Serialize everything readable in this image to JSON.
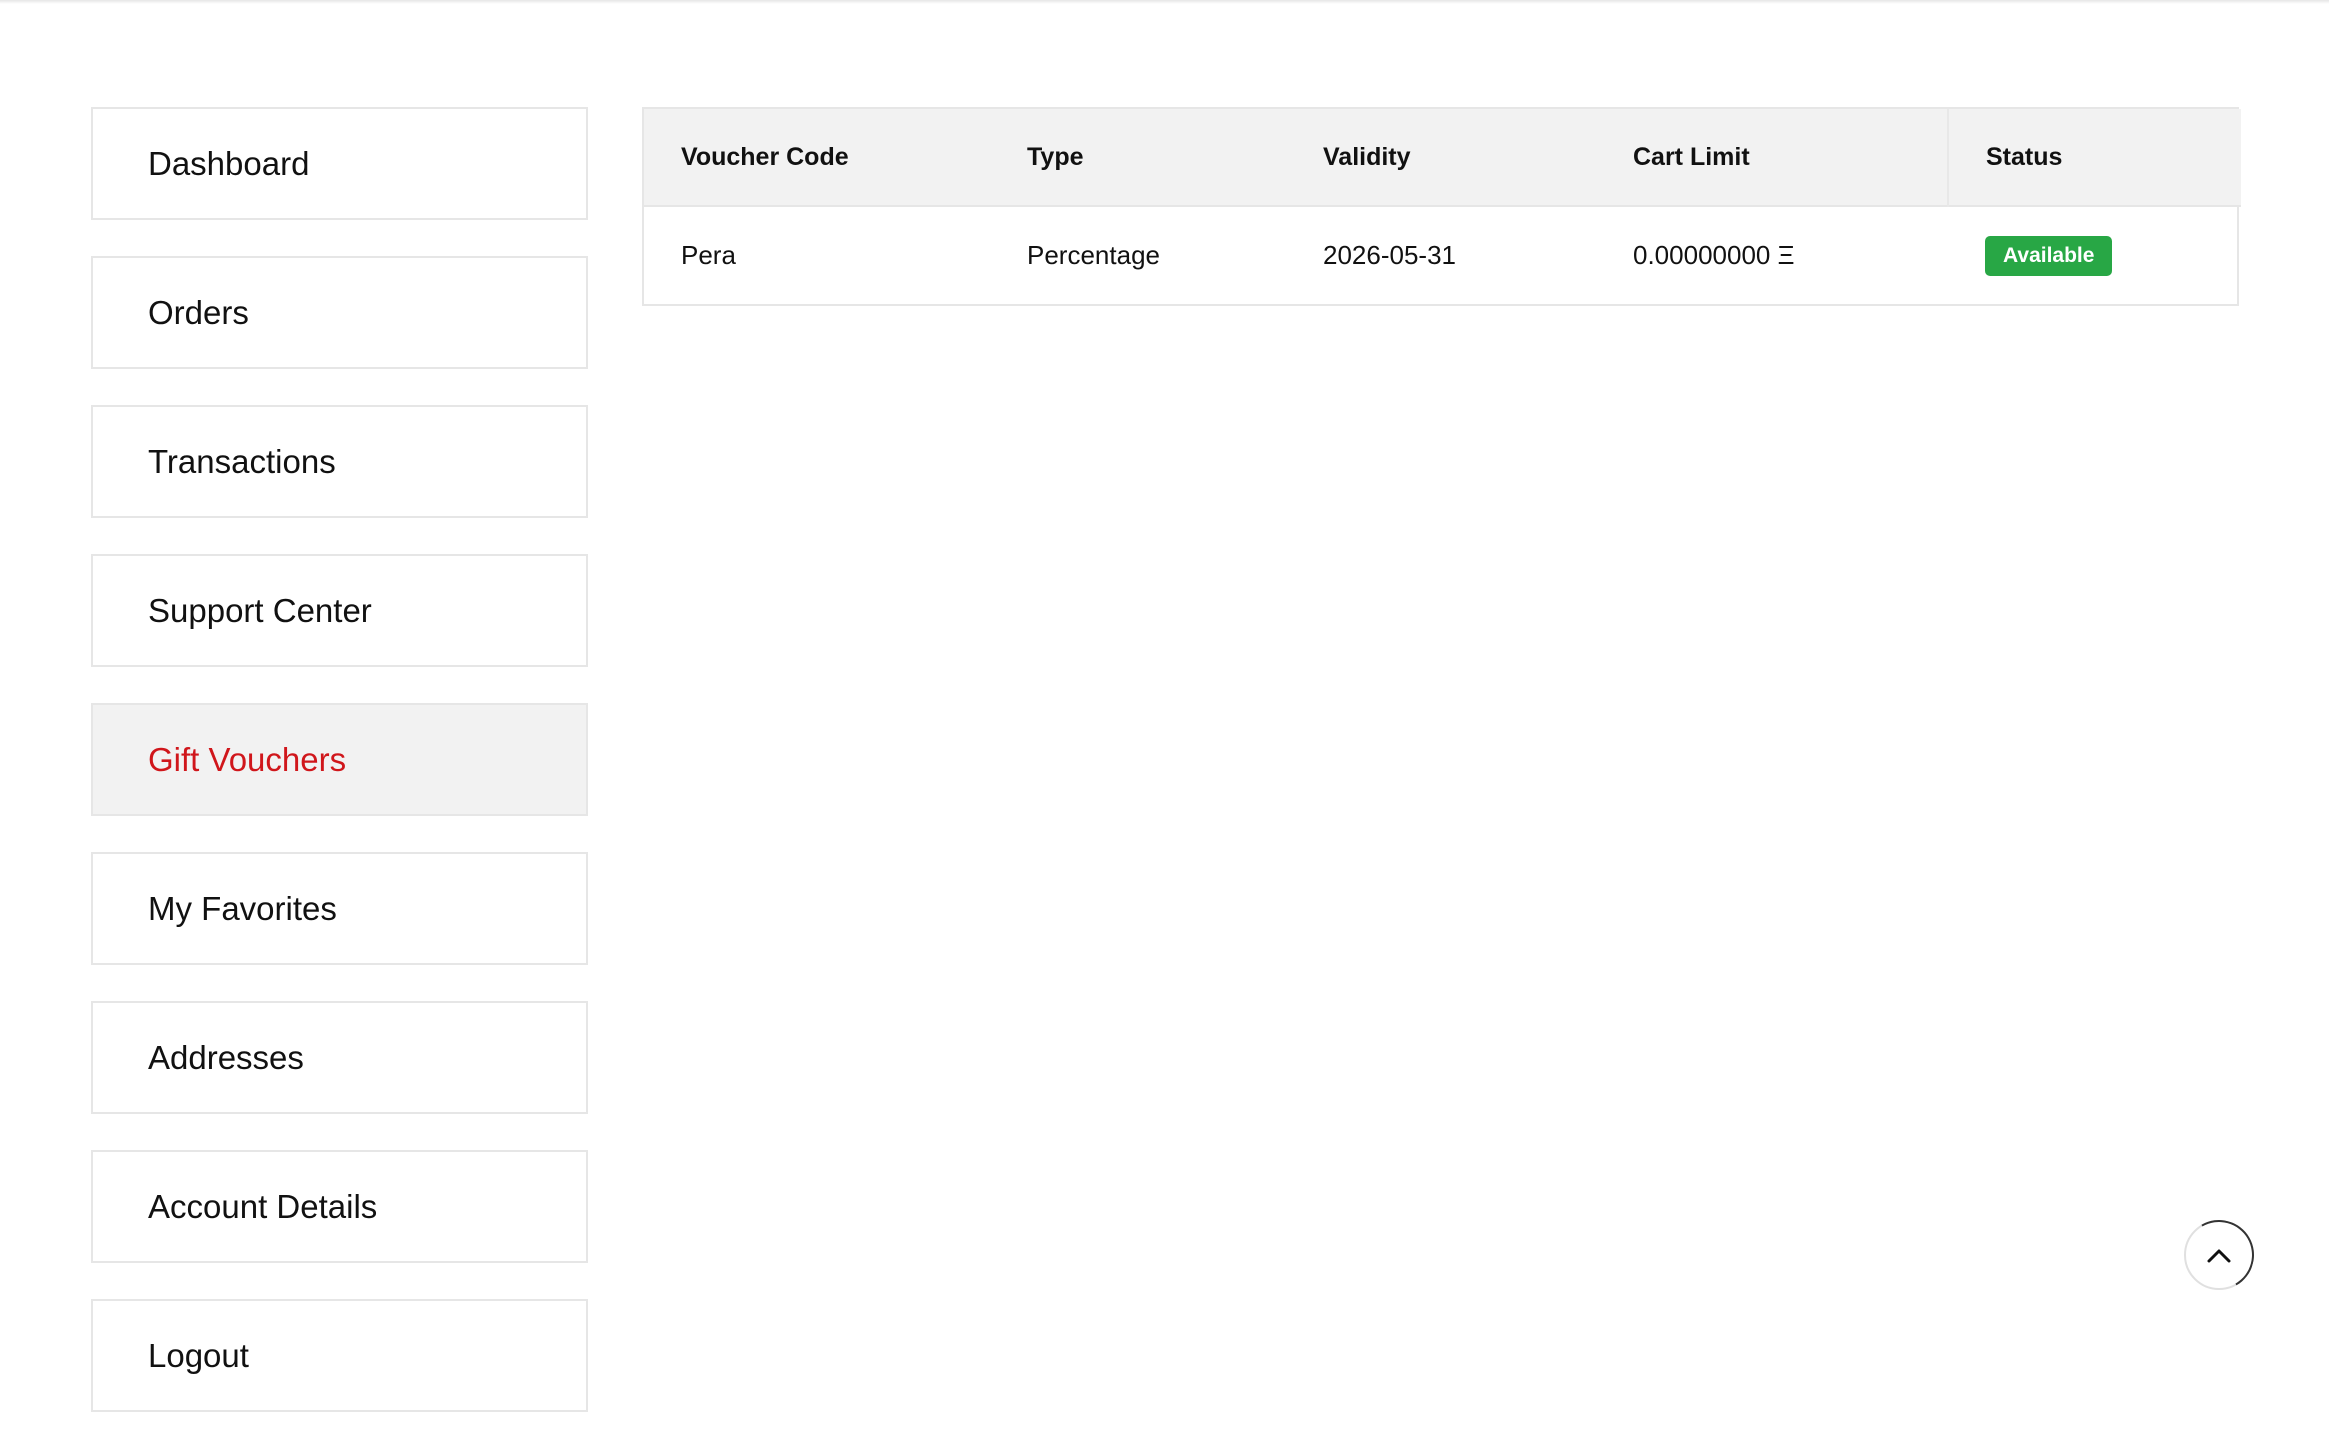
{
  "sidebar": {
    "items": [
      {
        "label": "Dashboard",
        "active": false
      },
      {
        "label": "Orders",
        "active": false
      },
      {
        "label": "Transactions",
        "active": false
      },
      {
        "label": "Support Center",
        "active": false
      },
      {
        "label": "Gift Vouchers",
        "active": true
      },
      {
        "label": "My Favorites",
        "active": false
      },
      {
        "label": "Addresses",
        "active": false
      },
      {
        "label": "Account Details",
        "active": false
      },
      {
        "label": "Logout",
        "active": false
      }
    ]
  },
  "table": {
    "headers": {
      "voucher_code": "Voucher Code",
      "type": "Type",
      "validity": "Validity",
      "cart_limit": "Cart Limit",
      "status": "Status"
    },
    "rows": [
      {
        "voucher_code": "Pera",
        "type": "Percentage",
        "validity": "2026-05-31",
        "cart_limit": "0.00000000 Ξ",
        "status": "Available"
      }
    ]
  },
  "colors": {
    "active_text": "#d0161b",
    "status_available": "#28a745"
  },
  "icons": {
    "scroll_top": "chevron-up-icon"
  }
}
